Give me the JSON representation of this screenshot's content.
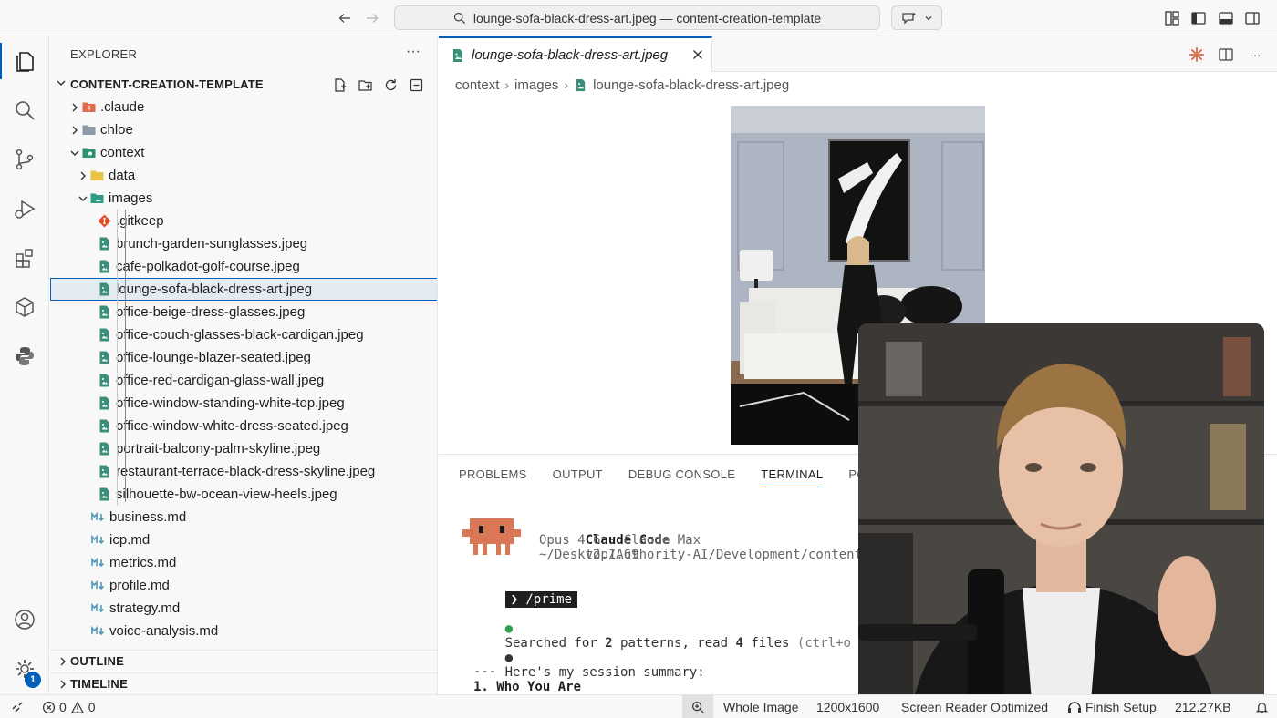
{
  "titlebar": {
    "search_text": "lounge-sofa-black-dress-art.jpeg — content-creation-template"
  },
  "explorer": {
    "title": "EXPLORER",
    "root_label": "CONTENT-CREATION-TEMPLATE",
    "tree": [
      {
        "label": ".claude",
        "depth": 0,
        "kind": "folder",
        "expanded": false,
        "icon": "claude-folder-icon"
      },
      {
        "label": "chloe",
        "depth": 0,
        "kind": "folder",
        "expanded": false,
        "icon": "folder-icon"
      },
      {
        "label": "context",
        "depth": 0,
        "kind": "folder",
        "expanded": true,
        "icon": "context-folder-icon"
      },
      {
        "label": "data",
        "depth": 1,
        "kind": "folder",
        "expanded": false,
        "icon": "data-folder-icon"
      },
      {
        "label": "images",
        "depth": 1,
        "kind": "folder",
        "expanded": true,
        "icon": "images-folder-icon"
      },
      {
        "label": ".gitkeep",
        "depth": 2,
        "kind": "file",
        "icon": "git-icon"
      },
      {
        "label": "brunch-garden-sunglasses.jpeg",
        "depth": 2,
        "kind": "file",
        "icon": "image-file-icon"
      },
      {
        "label": "cafe-polkadot-golf-course.jpeg",
        "depth": 2,
        "kind": "file",
        "icon": "image-file-icon"
      },
      {
        "label": "lounge-sofa-black-dress-art.jpeg",
        "depth": 2,
        "kind": "file",
        "icon": "image-file-icon",
        "selected": true
      },
      {
        "label": "office-beige-dress-glasses.jpeg",
        "depth": 2,
        "kind": "file",
        "icon": "image-file-icon"
      },
      {
        "label": "office-couch-glasses-black-cardigan.jpeg",
        "depth": 2,
        "kind": "file",
        "icon": "image-file-icon"
      },
      {
        "label": "office-lounge-blazer-seated.jpeg",
        "depth": 2,
        "kind": "file",
        "icon": "image-file-icon"
      },
      {
        "label": "office-red-cardigan-glass-wall.jpeg",
        "depth": 2,
        "kind": "file",
        "icon": "image-file-icon"
      },
      {
        "label": "office-window-standing-white-top.jpeg",
        "depth": 2,
        "kind": "file",
        "icon": "image-file-icon"
      },
      {
        "label": "office-window-white-dress-seated.jpeg",
        "depth": 2,
        "kind": "file",
        "icon": "image-file-icon"
      },
      {
        "label": "portrait-balcony-palm-skyline.jpeg",
        "depth": 2,
        "kind": "file",
        "icon": "image-file-icon"
      },
      {
        "label": "restaurant-terrace-black-dress-skyline.jpeg",
        "depth": 2,
        "kind": "file",
        "icon": "image-file-icon"
      },
      {
        "label": "silhouette-bw-ocean-view-heels.jpeg",
        "depth": 2,
        "kind": "file",
        "icon": "image-file-icon"
      },
      {
        "label": "business.md",
        "depth": 1,
        "kind": "file",
        "icon": "markdown-icon"
      },
      {
        "label": "icp.md",
        "depth": 1,
        "kind": "file",
        "icon": "markdown-icon"
      },
      {
        "label": "metrics.md",
        "depth": 1,
        "kind": "file",
        "icon": "markdown-icon"
      },
      {
        "label": "profile.md",
        "depth": 1,
        "kind": "file",
        "icon": "markdown-icon"
      },
      {
        "label": "strategy.md",
        "depth": 1,
        "kind": "file",
        "icon": "markdown-icon"
      },
      {
        "label": "voice-analysis.md",
        "depth": 1,
        "kind": "file",
        "icon": "markdown-icon"
      }
    ],
    "outline_label": "OUTLINE",
    "timeline_label": "TIMELINE"
  },
  "editor": {
    "tab_label": "lounge-sofa-black-dress-art.jpeg",
    "breadcrumb": [
      "context",
      "images",
      "lounge-sofa-black-dress-art.jpeg"
    ]
  },
  "panel": {
    "tabs": [
      "PROBLEMS",
      "OUTPUT",
      "DEBUG CONSOLE",
      "TERMINAL",
      "PORTS"
    ],
    "active_tab": "TERMINAL",
    "terminal": {
      "app_name": "Claude Code",
      "version": "v2.1.69",
      "model_line": "Opus 4.6 · Claude Max",
      "path_line": "~/Desktop/Authority-AI/Development/content-c",
      "prompt": "❯ /prime",
      "line1_prefix": "Searched for ",
      "line1_n1": "2",
      "line1_mid": " patterns, read ",
      "line1_n2": "4",
      "line1_suffix": " files ",
      "line1_hint": "(ctrl+o to expa",
      "line2": "Here's my session summary:",
      "rule": "---",
      "heading": "1. Who You Are"
    }
  },
  "activity": {
    "settings_badge": "1"
  },
  "statusbar": {
    "errors": "0",
    "warnings": "0",
    "zoom_label": "Whole Image",
    "dimensions": "1200x1600",
    "screen_reader": "Screen Reader Optimized",
    "finish_setup": "Finish Setup",
    "file_size": "212.27KB"
  },
  "colors": {
    "accent": "#005fb8",
    "image_icon": "#3a8f7a",
    "markdown_icon": "#519aba",
    "claude_folder": "#e06c4a",
    "mascot": "#d97757"
  }
}
